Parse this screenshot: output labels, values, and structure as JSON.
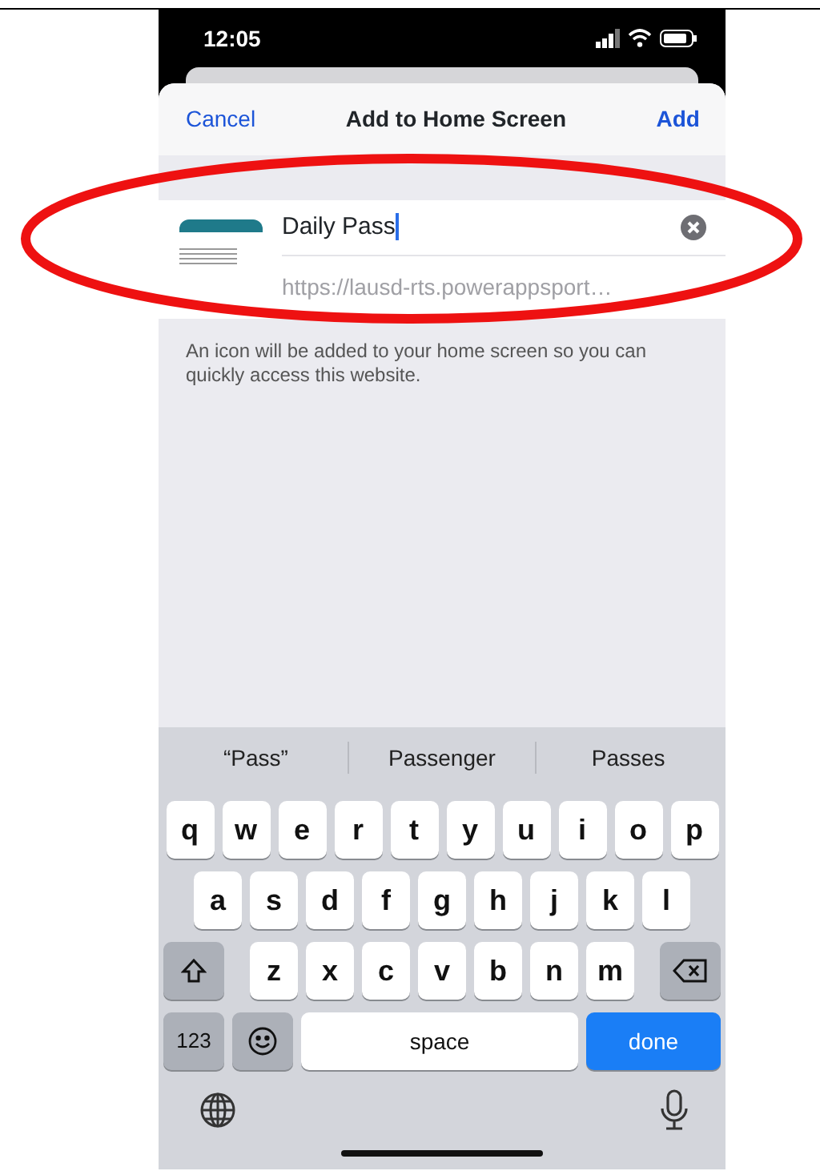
{
  "status_bar": {
    "time": "12:05"
  },
  "sheet": {
    "cancel": "Cancel",
    "title": "Add to Home Screen",
    "add": "Add"
  },
  "bookmark": {
    "name": "Daily Pass",
    "url": "https://lausd-rts.powerappsport…"
  },
  "note": "An icon will be added to your home screen so you can quickly access this website.",
  "suggestions": [
    "“Pass”",
    "Passenger",
    "Passes"
  ],
  "keyboard": {
    "rows": [
      [
        "q",
        "w",
        "e",
        "r",
        "t",
        "y",
        "u",
        "i",
        "o",
        "p"
      ],
      [
        "a",
        "s",
        "d",
        "f",
        "g",
        "h",
        "j",
        "k",
        "l"
      ],
      [
        "z",
        "x",
        "c",
        "v",
        "b",
        "n",
        "m"
      ]
    ],
    "numbers": "123",
    "space": "space",
    "done": "done"
  }
}
